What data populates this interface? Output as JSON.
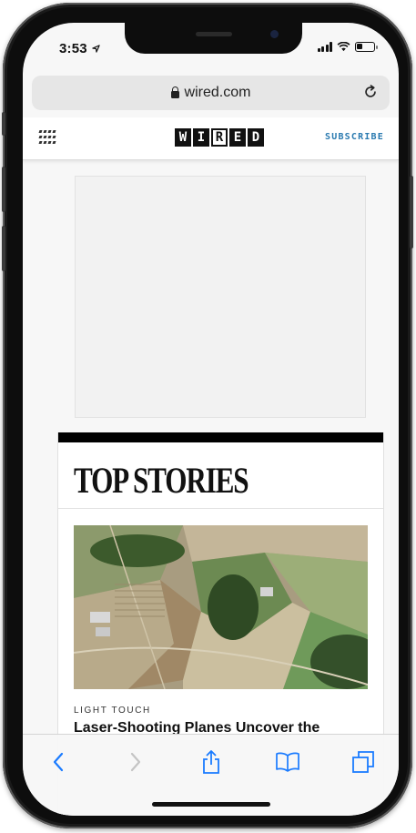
{
  "status_bar": {
    "time": "3:53",
    "location_icon": "location-arrow-icon",
    "signal_icon": "cellular-signal-icon",
    "wifi_icon": "wifi-icon",
    "battery_icon": "battery-icon",
    "battery_level": 0.3
  },
  "address_bar": {
    "url": "wired.com",
    "lock_icon": "lock-icon",
    "reload_icon": "reload-icon"
  },
  "site_header": {
    "menu_icon": "grid-menu-icon",
    "logo_letters": [
      "W",
      "I",
      "R",
      "E",
      "D"
    ],
    "logo_text": "WIRED",
    "subscribe_label": "SUBSCRIBE",
    "subscribe_color": "#2a7ab0"
  },
  "main": {
    "section_title": "TOP STORIES",
    "story": {
      "kicker": "LIGHT TOUCH",
      "headline": "Laser-Shooting Planes Uncover the"
    }
  },
  "toolbar": {
    "back_icon": "back-chevron-icon",
    "forward_icon": "forward-chevron-icon",
    "share_icon": "share-icon",
    "bookmarks_icon": "bookmarks-book-icon",
    "tabs_icon": "tabs-icon",
    "accent_color": "#1a7bff"
  }
}
